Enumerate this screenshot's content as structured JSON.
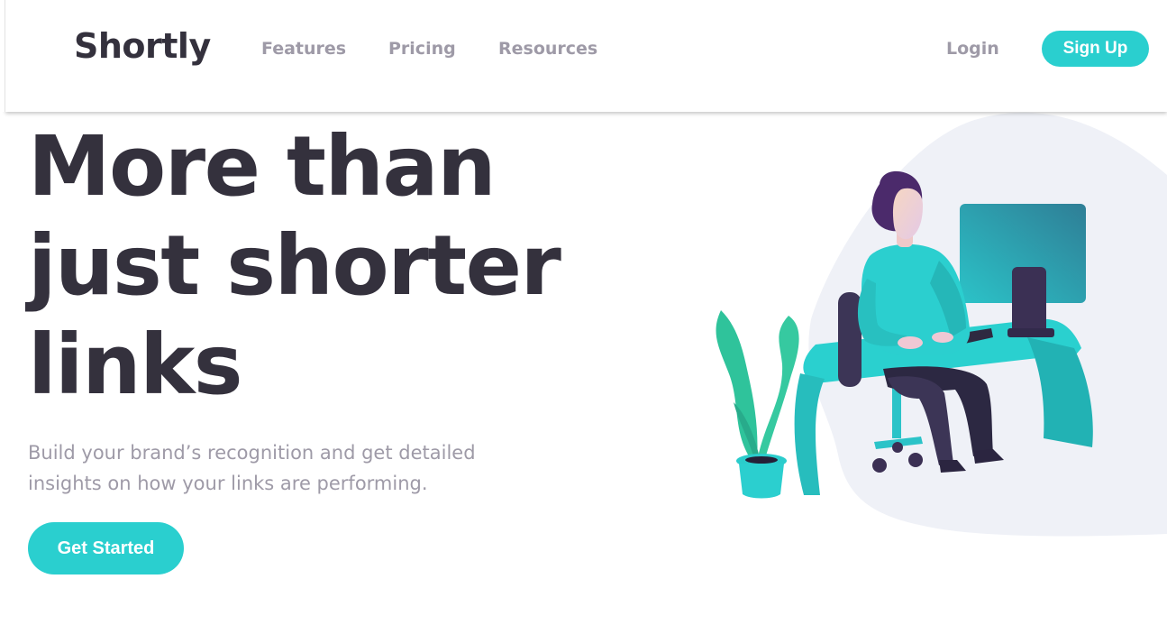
{
  "header": {
    "logo": "Shortly",
    "nav": {
      "features": "Features",
      "pricing": "Pricing",
      "resources": "Resources"
    },
    "login": "Login",
    "signup": "Sign Up"
  },
  "hero": {
    "title_lines": [
      "More than",
      "just shorter",
      "links"
    ],
    "subtitle_lines": [
      "Build your brand’s recognition and get detailed",
      "insights on how your links are performing."
    ],
    "cta": "Get Started"
  },
  "illustration": {
    "icon": "person-working-at-desk-illustration"
  },
  "colors": {
    "primary": "#2acfcf",
    "dark": "#34313d",
    "gray": "#9e9aa7",
    "blob": "#eff1f7",
    "dark_violet": "#3b3054"
  }
}
